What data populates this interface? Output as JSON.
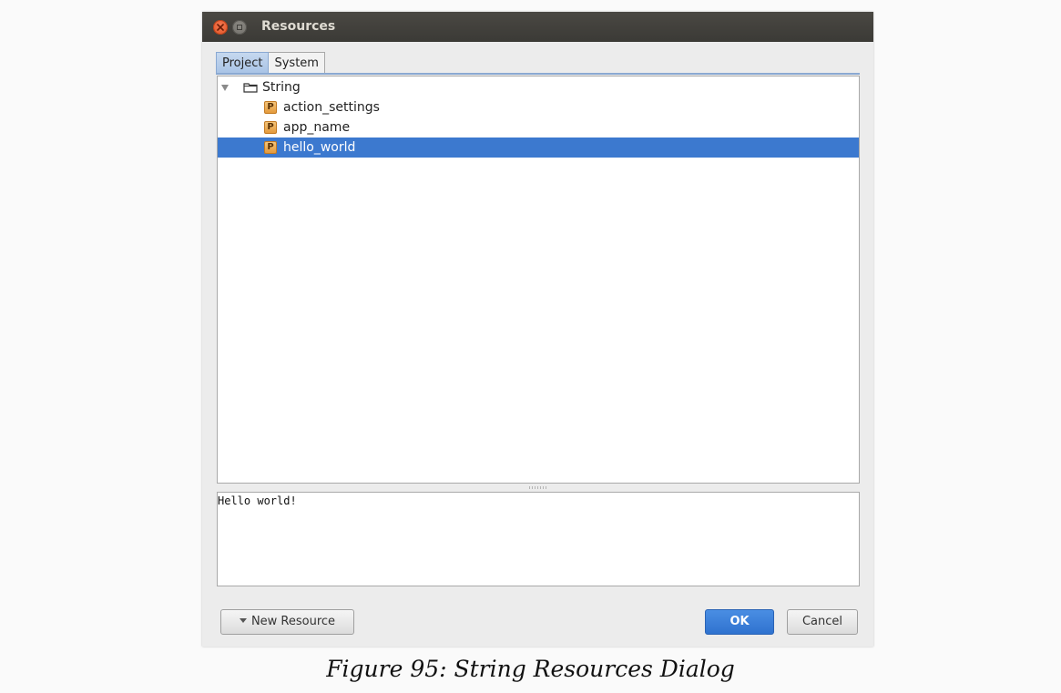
{
  "window": {
    "title": "Resources"
  },
  "tabs": [
    {
      "label": "Project",
      "active": true
    },
    {
      "label": "System",
      "active": false
    }
  ],
  "tree": {
    "folder": {
      "label": "String",
      "expanded": true
    },
    "items": [
      {
        "badge": "P",
        "label": "action_settings",
        "selected": false
      },
      {
        "badge": "P",
        "label": "app_name",
        "selected": false
      },
      {
        "badge": "P",
        "label": "hello_world",
        "selected": true
      }
    ]
  },
  "preview": {
    "text": "Hello world!"
  },
  "buttons": {
    "new_resource": "New Resource",
    "ok": "OK",
    "cancel": "Cancel"
  },
  "caption": "Figure 95: String Resources Dialog",
  "colors": {
    "selection": "#3c79cf",
    "titlebar": "#3b3a36",
    "ok_button": "#2f72cf",
    "badge": "#e49a3c"
  }
}
